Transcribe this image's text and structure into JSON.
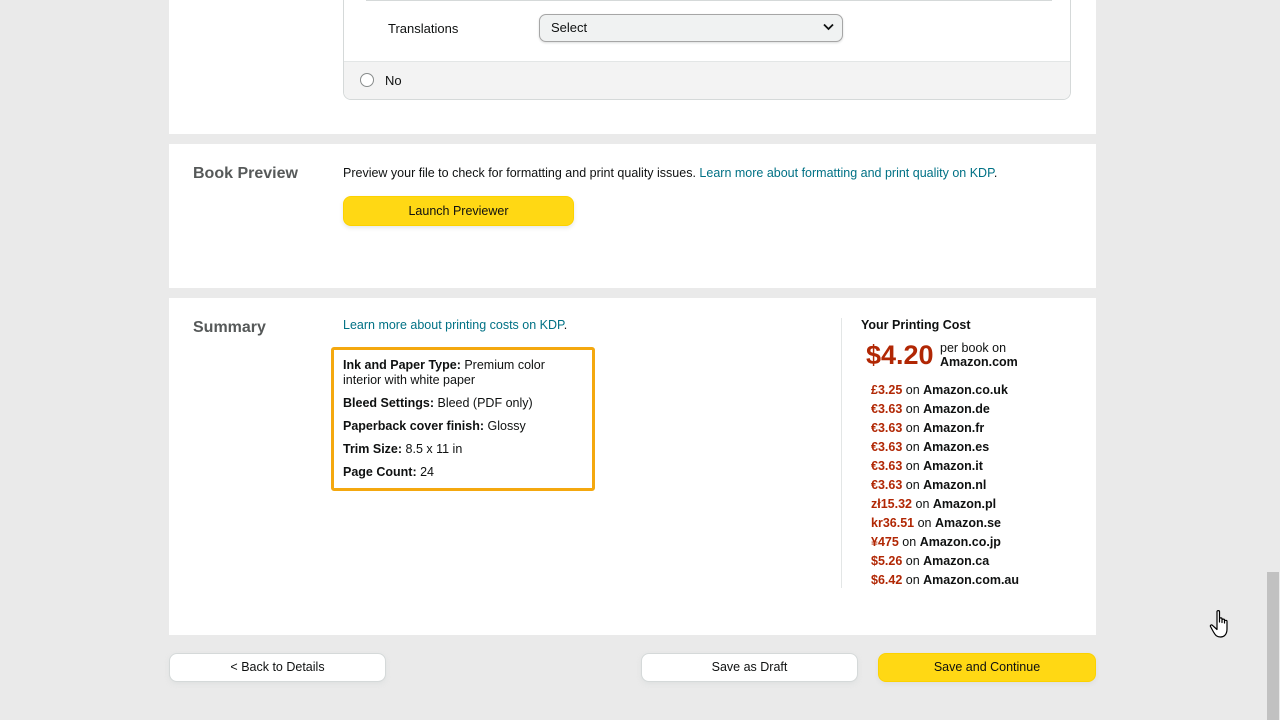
{
  "top_section": {
    "translations_label": "Translations",
    "translations_select_value": "Select",
    "no_option_label": "No"
  },
  "book_preview": {
    "title": "Book Preview",
    "description": "Preview your file to check for formatting and print quality issues.",
    "learn_link": "Learn more about formatting and print quality on KDP",
    "learn_link_suffix": ".",
    "launch_button": "Launch Previewer"
  },
  "summary": {
    "title": "Summary",
    "learn_cost_link": "Learn more about printing costs on KDP",
    "learn_cost_suffix": ".",
    "details": [
      {
        "label": "Ink and Paper Type:",
        "value": "Premium color interior with white paper"
      },
      {
        "label": "Bleed Settings:",
        "value": "Bleed (PDF only)"
      },
      {
        "label": "Paperback cover finish:",
        "value": "Glossy"
      },
      {
        "label": "Trim Size:",
        "value": "8.5 x 11 in"
      },
      {
        "label": "Page Count:",
        "value": "24"
      }
    ],
    "printing_cost": {
      "title": "Your Printing Cost",
      "main_price": "$4.20",
      "per_book_text": "per book on",
      "main_marketplace": "Amazon.com",
      "on_word": "on",
      "marketplaces": [
        {
          "price": "£3.25",
          "market": "Amazon.co.uk"
        },
        {
          "price": "€3.63",
          "market": "Amazon.de"
        },
        {
          "price": "€3.63",
          "market": "Amazon.fr"
        },
        {
          "price": "€3.63",
          "market": "Amazon.es"
        },
        {
          "price": "€3.63",
          "market": "Amazon.it"
        },
        {
          "price": "€3.63",
          "market": "Amazon.nl"
        },
        {
          "price": "zł15.32",
          "market": "Amazon.pl"
        },
        {
          "price": "kr36.51",
          "market": "Amazon.se"
        },
        {
          "price": "¥475",
          "market": "Amazon.co.jp"
        },
        {
          "price": "$5.26",
          "market": "Amazon.ca"
        },
        {
          "price": "$6.42",
          "market": "Amazon.com.au"
        }
      ]
    }
  },
  "footer": {
    "back_button": "< Back to Details",
    "draft_button": "Save as Draft",
    "continue_button": "Save and Continue"
  },
  "colors": {
    "accent_yellow": "#ffd814",
    "link": "#007185",
    "price_red": "#b12704",
    "highlight_orange": "#f4a80f"
  }
}
